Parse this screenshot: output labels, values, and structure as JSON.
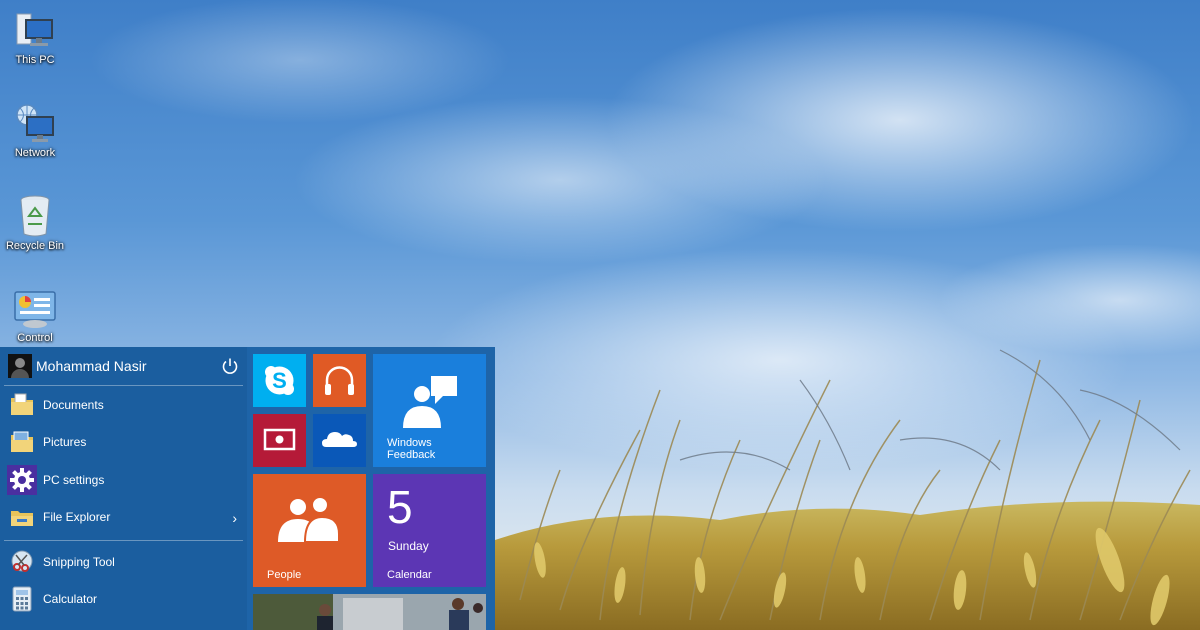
{
  "desktop": {
    "icons": [
      {
        "label": "This PC",
        "icon": "this-pc-icon"
      },
      {
        "label": "Network",
        "icon": "network-icon"
      },
      {
        "label": "Recycle Bin",
        "icon": "recycle-bin-icon"
      },
      {
        "label": "Control",
        "icon": "control-panel-icon"
      }
    ]
  },
  "start_menu": {
    "user": {
      "name": "Mohammad Nasir"
    },
    "items": [
      {
        "label": "Documents",
        "icon": "documents-folder-icon"
      },
      {
        "label": "Pictures",
        "icon": "pictures-folder-icon"
      },
      {
        "label": "PC settings",
        "icon": "gear-icon"
      },
      {
        "label": "File Explorer",
        "icon": "file-explorer-icon",
        "has_submenu": true
      },
      {
        "label": "Snipping Tool",
        "icon": "snipping-tool-icon"
      },
      {
        "label": "Calculator",
        "icon": "calculator-icon"
      }
    ],
    "tiles": {
      "skype": {
        "color": "#00aff0"
      },
      "music": {
        "color": "#e05a25"
      },
      "video": {
        "color": "#b51a38"
      },
      "onedrive": {
        "color": "#0a58b8"
      },
      "windows_feedback": {
        "label": "Windows Feedback",
        "color": "#1a7fdc"
      },
      "people": {
        "label": "People",
        "color": "#de5a27"
      },
      "calendar": {
        "label": "Calendar",
        "day_number": "5",
        "day_name": "Sunday",
        "color": "#5c36b4"
      }
    }
  },
  "colors": {
    "start_left_bg": "#1b5e9f",
    "start_right_bg": "#1e64a8"
  }
}
